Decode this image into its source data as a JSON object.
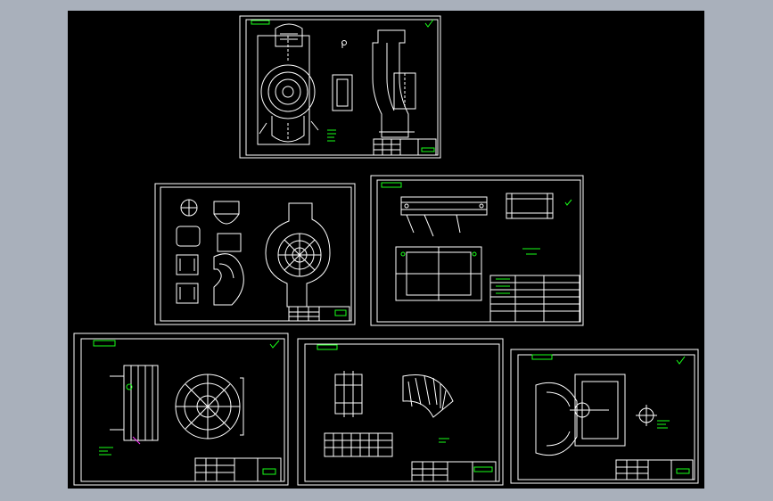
{
  "app": {
    "background": "#a9b0bb",
    "viewport_background": "#000000",
    "line_color": "#ffffff",
    "accent_green": "#19ff19",
    "accent_magenta": "#ff33ff"
  },
  "sheets": [
    {
      "id": "sheet-1",
      "content": "pump-casing-section"
    },
    {
      "id": "sheet-2",
      "content": "pattern-views"
    },
    {
      "id": "sheet-3",
      "content": "box-frame"
    },
    {
      "id": "sheet-4",
      "content": "impeller-section"
    },
    {
      "id": "sheet-5",
      "content": "volute-development"
    },
    {
      "id": "sheet-6",
      "content": "impeller-assembly"
    }
  ]
}
